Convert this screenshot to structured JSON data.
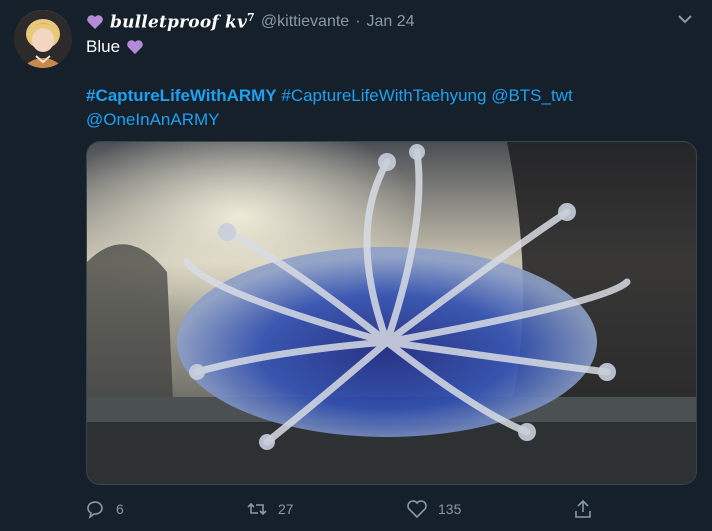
{
  "tweet": {
    "display_name": "bulletproof kv",
    "name_superscript": "7",
    "handle": "@kittievante",
    "separator": "·",
    "date": "Jan 24",
    "text": "Blue",
    "hashtags": {
      "first": "#CaptureLifeWithARMY",
      "second": "#CaptureLifeWithTaehyung",
      "mention1": "@BTS_twt",
      "mention2": "@OneInAnARMY"
    },
    "media": {
      "description_icon": "photo"
    }
  },
  "actions": {
    "reply_count": "6",
    "retweet_count": "27",
    "like_count": "135"
  },
  "colors": {
    "background": "#15202b",
    "link": "#1da1f2",
    "muted": "#8899a6",
    "heart": "#b38bd6"
  }
}
